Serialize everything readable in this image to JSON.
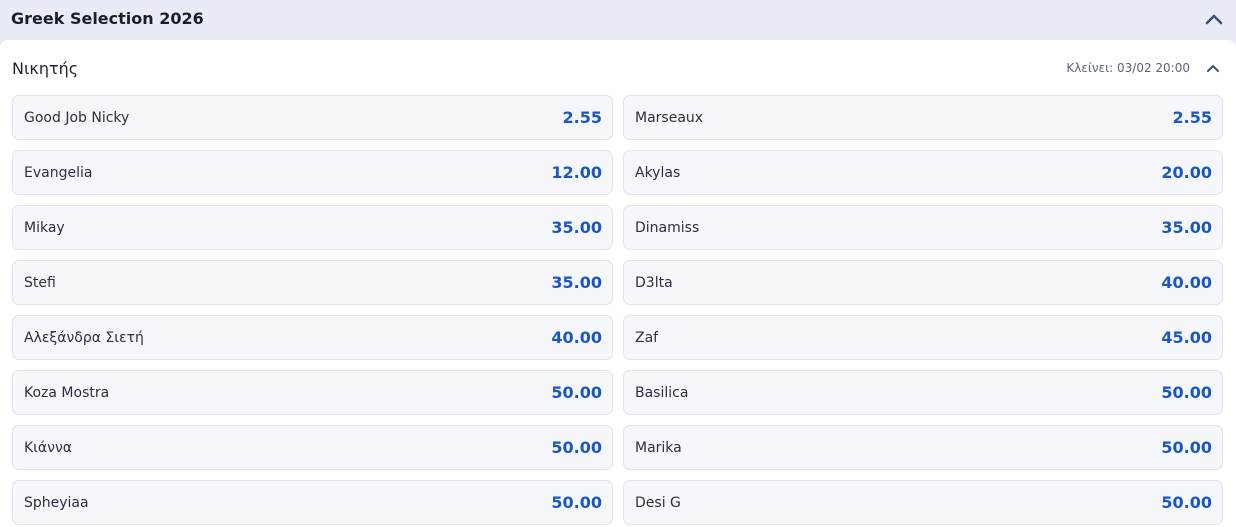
{
  "event": {
    "title": "Greek Selection 2026"
  },
  "market": {
    "title": "Νικητής",
    "closes": "Κλείνει: 03/02 20:00"
  },
  "selections": [
    {
      "name": "Good Job Nicky",
      "odds": "2.55"
    },
    {
      "name": "Marseaux",
      "odds": "2.55"
    },
    {
      "name": "Evangelia",
      "odds": "12.00"
    },
    {
      "name": "Akylas",
      "odds": "20.00"
    },
    {
      "name": "Mikay",
      "odds": "35.00"
    },
    {
      "name": "Dinamiss",
      "odds": "35.00"
    },
    {
      "name": "Stefi",
      "odds": "35.00"
    },
    {
      "name": "D3lta",
      "odds": "40.00"
    },
    {
      "name": "Αλεξάνδρα Σιετή",
      "odds": "40.00"
    },
    {
      "name": "Zaf",
      "odds": "45.00"
    },
    {
      "name": "Koza Mostra",
      "odds": "50.00"
    },
    {
      "name": "Basilica",
      "odds": "50.00"
    },
    {
      "name": "Κιάννα",
      "odds": "50.00"
    },
    {
      "name": "Marika",
      "odds": "50.00"
    },
    {
      "name": "Spheyiaa",
      "odds": "50.00"
    },
    {
      "name": "Desi G",
      "odds": "50.00"
    }
  ],
  "icons": {
    "event_collapse": "chevron-up-icon",
    "market_collapse": "chevron-up-icon"
  },
  "colors": {
    "odds": "#1957c2",
    "header_bg": "#e9ecf6",
    "card_bg": "#f6f7fb"
  }
}
